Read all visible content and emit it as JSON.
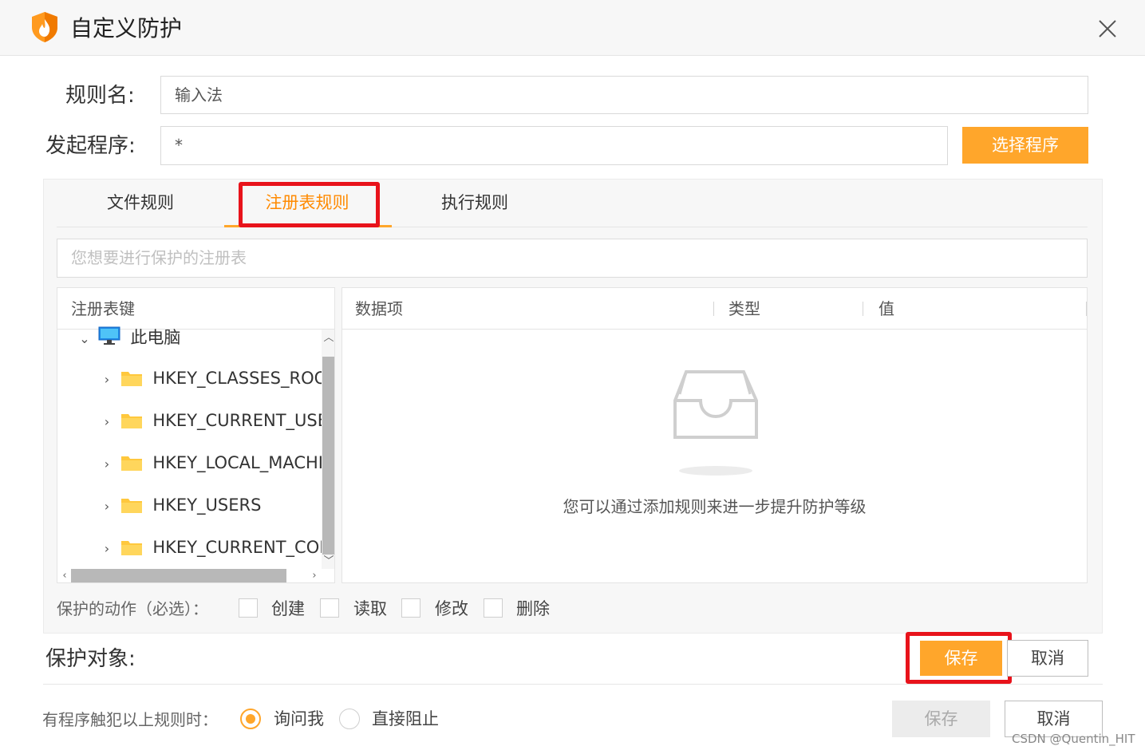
{
  "window": {
    "title": "自定义防护",
    "close_icon": "close-icon"
  },
  "form": {
    "rule_name_label": "规则名:",
    "rule_name_value": "输入法",
    "program_label": "发起程序:",
    "program_value": "*",
    "select_program_button": "选择程序"
  },
  "tabs": [
    {
      "label": "文件规则",
      "active": false
    },
    {
      "label": "注册表规则",
      "active": true
    },
    {
      "label": "执行规则",
      "active": false
    }
  ],
  "registry_search": {
    "placeholder": "您想要进行保护的注册表"
  },
  "tree": {
    "header": "注册表键",
    "root": {
      "label": "此电脑",
      "icon": "computer-icon",
      "expanded": true
    },
    "keys": [
      {
        "label": "HKEY_CLASSES_ROOT",
        "icon": "folder-icon"
      },
      {
        "label": "HKEY_CURRENT_USER",
        "icon": "folder-icon"
      },
      {
        "label": "HKEY_LOCAL_MACHINE",
        "icon": "folder-icon"
      },
      {
        "label": "HKEY_USERS",
        "icon": "folder-icon"
      },
      {
        "label": "HKEY_CURRENT_CONFIG",
        "icon": "folder-icon"
      }
    ]
  },
  "data_table": {
    "columns": [
      "数据项",
      "类型",
      "值"
    ],
    "empty_icon": "empty-inbox-icon",
    "empty_text": "您可以通过添加规则来进一步提升防护等级"
  },
  "actions": {
    "label": "保护的动作（必选）：",
    "options": [
      {
        "label": "创建",
        "checked": false
      },
      {
        "label": "读取",
        "checked": false
      },
      {
        "label": "修改",
        "checked": false
      },
      {
        "label": "删除",
        "checked": false
      }
    ]
  },
  "protect_target": {
    "label": "保护对象:",
    "save_button": "保存",
    "cancel_button": "取消"
  },
  "policy": {
    "label": "有程序触犯以上规则时：",
    "options": [
      {
        "label": "询问我",
        "selected": true
      },
      {
        "label": "直接阻止",
        "selected": false
      }
    ],
    "save_button": "保存",
    "cancel_button": "取消"
  },
  "watermark": "CSDN @Quentin_HIT",
  "colors": {
    "accent": "#ffa62b",
    "active_tab_text": "#ff8a00",
    "highlight": "#e8131b"
  }
}
